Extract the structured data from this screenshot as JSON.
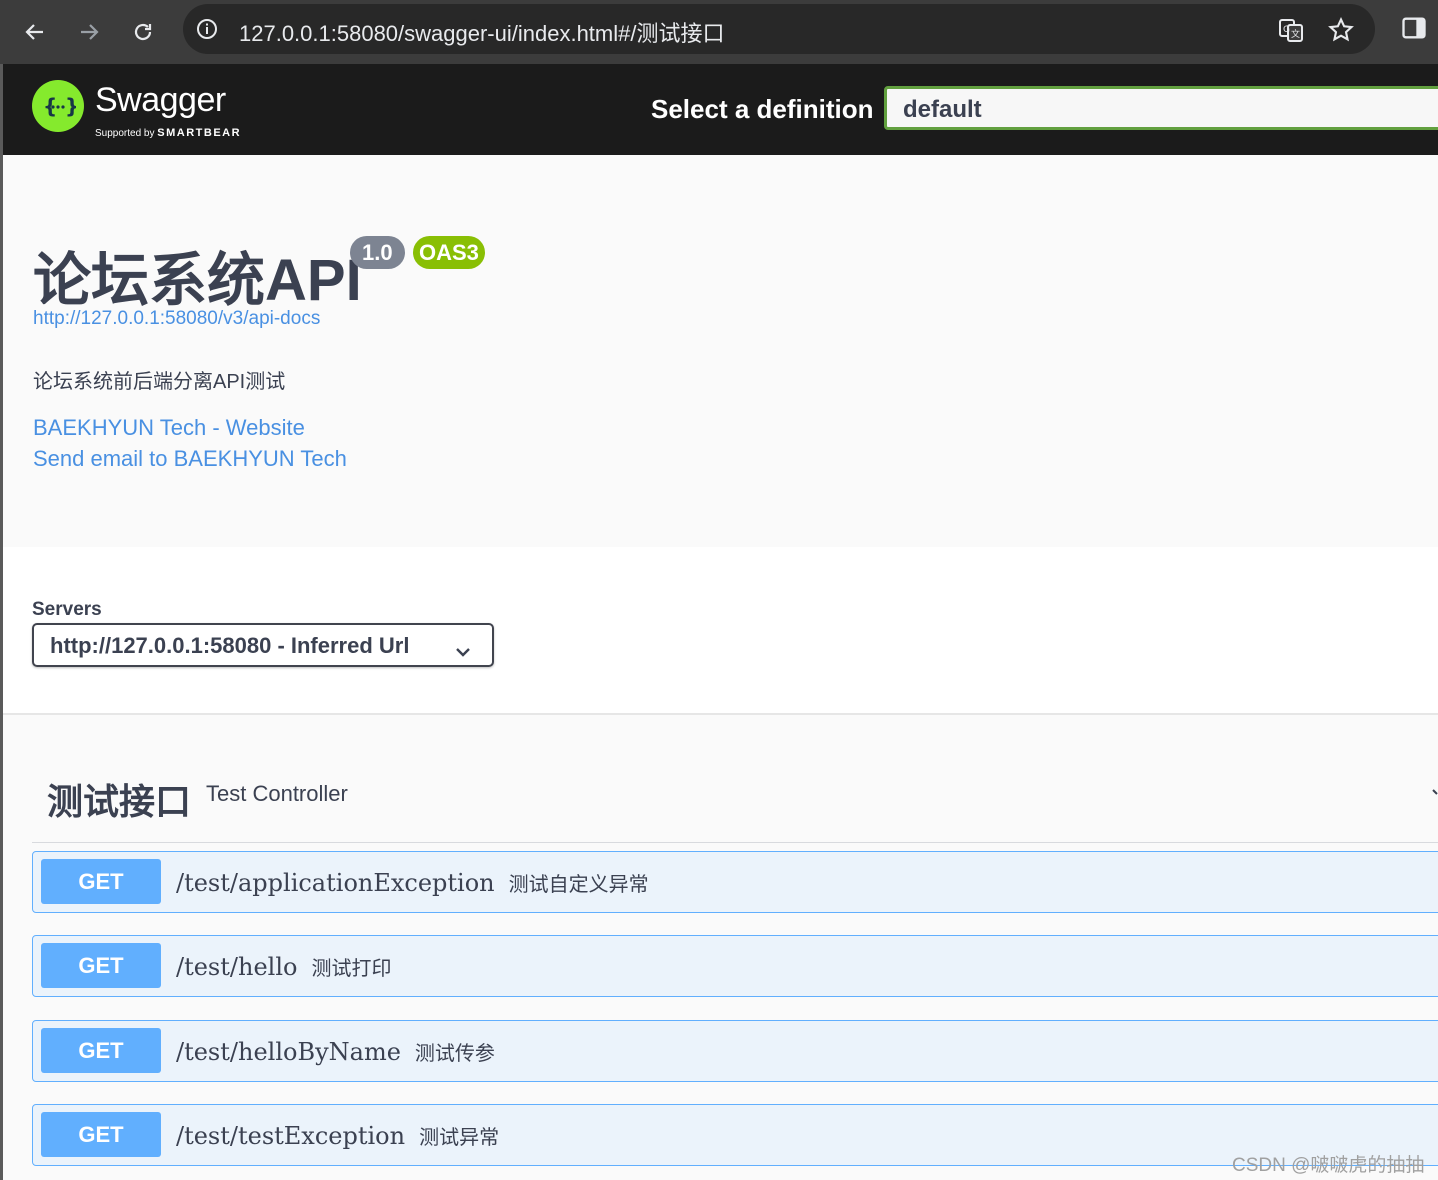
{
  "browser": {
    "url": "127.0.0.1:58080/swagger-ui/index.html#/测试接口"
  },
  "topbar": {
    "logo_text": "Swagger",
    "logo_supported_by": "Supported by",
    "logo_brand": "SMARTBEAR",
    "select_label": "Select a definition",
    "select_value": "default"
  },
  "info": {
    "title": "论坛系统API",
    "version": "1.0",
    "oas_badge": "OAS3",
    "docs_url": "http://127.0.0.1:58080/v3/api-docs",
    "description": "论坛系统前后端分离API测试",
    "website_link": "BAEKHYUN Tech - Website",
    "email_link": "Send email to BAEKHYUN Tech"
  },
  "servers": {
    "label": "Servers",
    "selected": "http://127.0.0.1:58080 - Inferred Url"
  },
  "tag": {
    "name": "测试接口",
    "description": "Test Controller"
  },
  "operations": [
    {
      "method": "GET",
      "path": "/test/applicationException",
      "summary": "测试自定义异常"
    },
    {
      "method": "GET",
      "path": "/test/hello",
      "summary": "测试打印"
    },
    {
      "method": "GET",
      "path": "/test/helloByName",
      "summary": "测试传参"
    },
    {
      "method": "GET",
      "path": "/test/testException",
      "summary": "测试异常"
    }
  ],
  "watermark": "CSDN @啵啵虎的抽抽",
  "colors": {
    "get_accent": "#61affe",
    "logo_green": "#85ea2d",
    "link_blue": "#4990e2"
  }
}
